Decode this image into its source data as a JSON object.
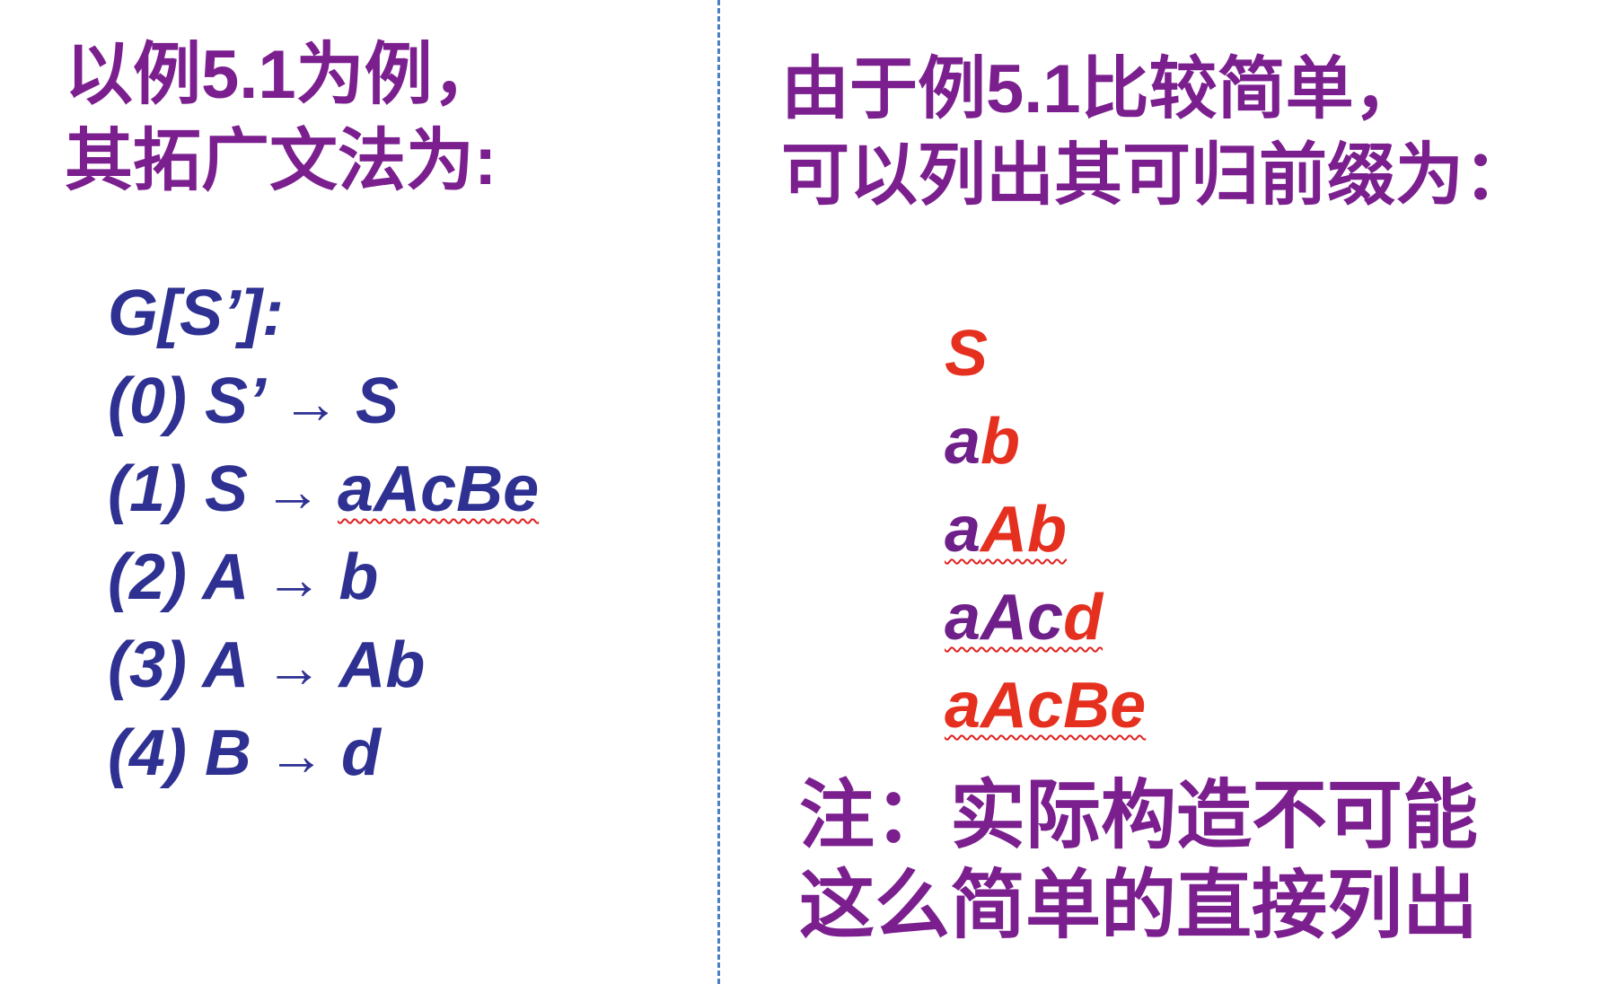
{
  "left": {
    "heading": [
      "以例5.1为例，",
      "其拓广文法为:"
    ],
    "grammar_title": "G[S’]:",
    "productions": [
      {
        "num": "(0)",
        "lhs": "S’",
        "arrow": "→",
        "rhs": "S"
      },
      {
        "num": "(1)",
        "lhs": "S",
        "arrow": "→",
        "rhs": "aAcBe"
      },
      {
        "num": "(2)",
        "lhs": "A",
        "arrow": "→",
        "rhs": "b"
      },
      {
        "num": "(3)",
        "lhs": "A",
        "arrow": "→",
        "rhs": "Ab"
      },
      {
        "num": "(4)",
        "lhs": "B",
        "arrow": "→",
        "rhs": "d"
      }
    ]
  },
  "right": {
    "heading": [
      "由于例5.1比较简单，",
      "可以列出其可归前缀为："
    ],
    "prefixes": [
      {
        "plain": "",
        "highlight": "S"
      },
      {
        "plain": "a",
        "highlight": "b"
      },
      {
        "plain": "a",
        "highlight": "Ab"
      },
      {
        "plain": "aAc",
        "highlight": "d"
      },
      {
        "plain": "",
        "highlight": "aAcBe"
      }
    ],
    "note": [
      "注：实际构造不可能",
      "这么简单的直接列出"
    ]
  },
  "colors": {
    "heading": "#7b1f8f",
    "grammar": "#2e3192",
    "highlight": "#e53020",
    "divider": "#4a7fc1"
  }
}
